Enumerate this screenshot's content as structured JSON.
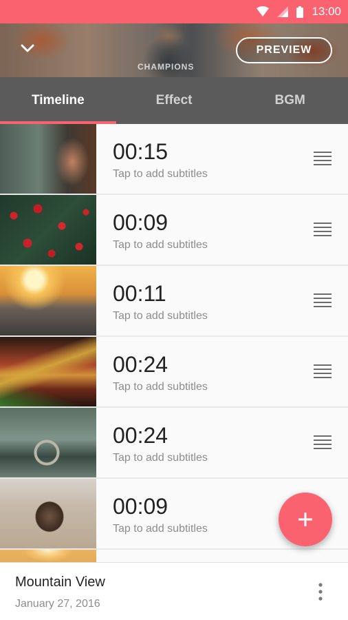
{
  "status_bar": {
    "time": "13:00",
    "icons": [
      "wifi-icon",
      "signal-icon",
      "battery-icon"
    ],
    "color": "#fb6270"
  },
  "header": {
    "back_icon": "chevron-down-icon",
    "preview_label": "PREVIEW"
  },
  "hero": {
    "shirt_text": "CHAMPIONS"
  },
  "tabs": [
    {
      "label": "Timeline",
      "active": true
    },
    {
      "label": "Effect",
      "active": false
    },
    {
      "label": "BGM",
      "active": false
    }
  ],
  "clips": [
    {
      "duration": "00:15",
      "subtitle_hint": "Tap to add subtitles"
    },
    {
      "duration": "00:09",
      "subtitle_hint": "Tap to add subtitles"
    },
    {
      "duration": "00:11",
      "subtitle_hint": "Tap to add subtitles"
    },
    {
      "duration": "00:24",
      "subtitle_hint": "Tap to add subtitles"
    },
    {
      "duration": "00:24",
      "subtitle_hint": "Tap to add subtitles"
    },
    {
      "duration": "00:09",
      "subtitle_hint": "Tap to add subtitles"
    }
  ],
  "fab": {
    "icon": "plus-icon",
    "color": "#fb6270"
  },
  "footer": {
    "title": "Mountain View",
    "date": "January 27, 2016",
    "menu_icon": "more-vertical-icon"
  },
  "colors": {
    "accent": "#fb6270",
    "tab_bar": "#5b5b5b"
  }
}
